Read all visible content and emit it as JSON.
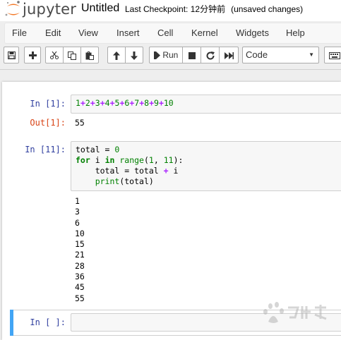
{
  "header": {
    "logo_text": "jupyter",
    "notebook_title": "Untitled",
    "checkpoint_text": "Last Checkpoint: 12分钟前",
    "unsaved_text": "(unsaved changes)"
  },
  "menubar": {
    "items": [
      "File",
      "Edit",
      "View",
      "Insert",
      "Cell",
      "Kernel",
      "Widgets",
      "Help"
    ]
  },
  "toolbar": {
    "buttons": [
      "save-icon",
      "plus-icon",
      "scissors-icon",
      "copy-icon",
      "paste-icon",
      "arrow-up-icon",
      "arrow-down-icon",
      "run-icon",
      "stop-icon",
      "restart-icon",
      "fast-forward-icon",
      "keyboard-icon"
    ],
    "run_label": "Run",
    "cell_type": "Code"
  },
  "cells": [
    {
      "in_prompt": "In [1]:",
      "source": "1+2+3+4+5+6+7+8+9+10",
      "out_prompt": "Out[1]:",
      "output": "55"
    },
    {
      "in_prompt": "In [11]:",
      "source_lines": [
        "total = 0",
        "for i in range(1, 11):",
        "    total = total + i",
        "    print(total)"
      ],
      "output": "1\n3\n6\n10\n15\n21\n28\n36\n45\n55"
    },
    {
      "in_prompt": "In [ ]:",
      "source": ""
    }
  ],
  "colors": {
    "selected_cell_bar": "#42a5f5",
    "in_prompt": "#303f9f",
    "out_prompt": "#d84315",
    "keyword": "#008000",
    "operator": "#aa22ff",
    "logo_orange": "#f37726"
  }
}
